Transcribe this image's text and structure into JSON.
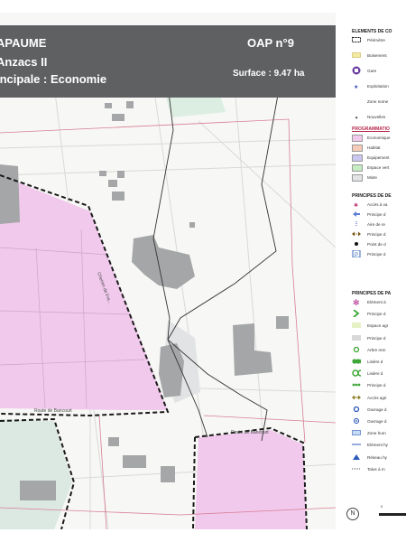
{
  "header": {
    "line1": "APAUME",
    "line2": "Anzacs II",
    "line3": "incipale : Economie",
    "oap": "OAP n°9",
    "surface": "Surface : 9.47 ha"
  },
  "map_labels": {
    "road_1": "Chemin de Fre...",
    "road_2": "Route de Bancourt",
    "road_3": "Route de Bancourt"
  },
  "legend": {
    "sections": [
      {
        "title": "ELEMENTS DE CO",
        "style": "black",
        "items": [
          {
            "icon": "dashed-perimeter-icon",
            "label": "Périmètre"
          },
          {
            "icon": "yellow-box-icon",
            "label": "Boisement"
          },
          {
            "icon": "station-icon",
            "label": "Gare"
          },
          {
            "icon": "star-icon",
            "label": "Exploitation"
          },
          {
            "icon": "zone-icon",
            "label": "Zone nome"
          },
          {
            "icon": "small-star-icon",
            "label": "Nouvelles"
          }
        ]
      },
      {
        "title": "PROGRAMMATIO",
        "style": "red",
        "items": [
          {
            "icon": "swatch-pink",
            "label": "Economique",
            "color": "#f1c9ec"
          },
          {
            "icon": "swatch-salmon",
            "label": "Habitat",
            "color": "#f7cbb9"
          },
          {
            "icon": "swatch-violet",
            "label": "Equipement",
            "color": "#c9c7f1"
          },
          {
            "icon": "swatch-green",
            "label": "Espace vert",
            "color": "#c6ecc3"
          },
          {
            "icon": "swatch-grey",
            "label": "Mixte",
            "color": "#e2e3e4"
          }
        ]
      },
      {
        "title": "PRINCIPES DE DE",
        "style": "black",
        "items": [
          {
            "icon": "pink-star-icon",
            "label": "Accès à va"
          },
          {
            "icon": "blue-arrow-icon",
            "label": "Principe d"
          },
          {
            "icon": "blue-dashed-icon",
            "label": "Aire de re"
          },
          {
            "icon": "brown-double-arrow-icon",
            "label": "Principe d"
          },
          {
            "icon": "dot-icon",
            "label": "Point de d"
          },
          {
            "icon": "parking-icon",
            "label": "Principe d"
          }
        ]
      },
      {
        "title": "PRINCIPES DE PA",
        "style": "black",
        "items": [
          {
            "icon": "magenta-asterisk-icon",
            "label": "Elément à"
          },
          {
            "icon": "green-chevron-icon",
            "label": "Principe d"
          },
          {
            "icon": "swatch-lightgreen",
            "label": "Espace agr"
          },
          {
            "icon": "swatch-lightgrey",
            "label": "Principe d"
          },
          {
            "icon": "green-ring-icon",
            "label": "Arbre rem"
          },
          {
            "icon": "tree-row-icon",
            "label": "Lisière d"
          },
          {
            "icon": "double-ring-icon",
            "label": "Lisière d"
          },
          {
            "icon": "green-dots-icon",
            "label": "Principe d"
          },
          {
            "icon": "olive-arrow-icon",
            "label": "Accès agri"
          },
          {
            "icon": "blue-ring-icon",
            "label": "Ouvrage d"
          },
          {
            "icon": "blue-ring-2-icon",
            "label": "Ouvrage d"
          },
          {
            "icon": "blue-rect-icon",
            "label": "Zone hum"
          },
          {
            "icon": "blue-line-icon",
            "label": "Elément hy"
          },
          {
            "icon": "blue-triangle-icon",
            "label": "Réseau hy"
          },
          {
            "icon": "dotted-line-icon",
            "label": "Talus à m"
          }
        ]
      }
    ],
    "scale_label": "0",
    "compass": "N"
  }
}
